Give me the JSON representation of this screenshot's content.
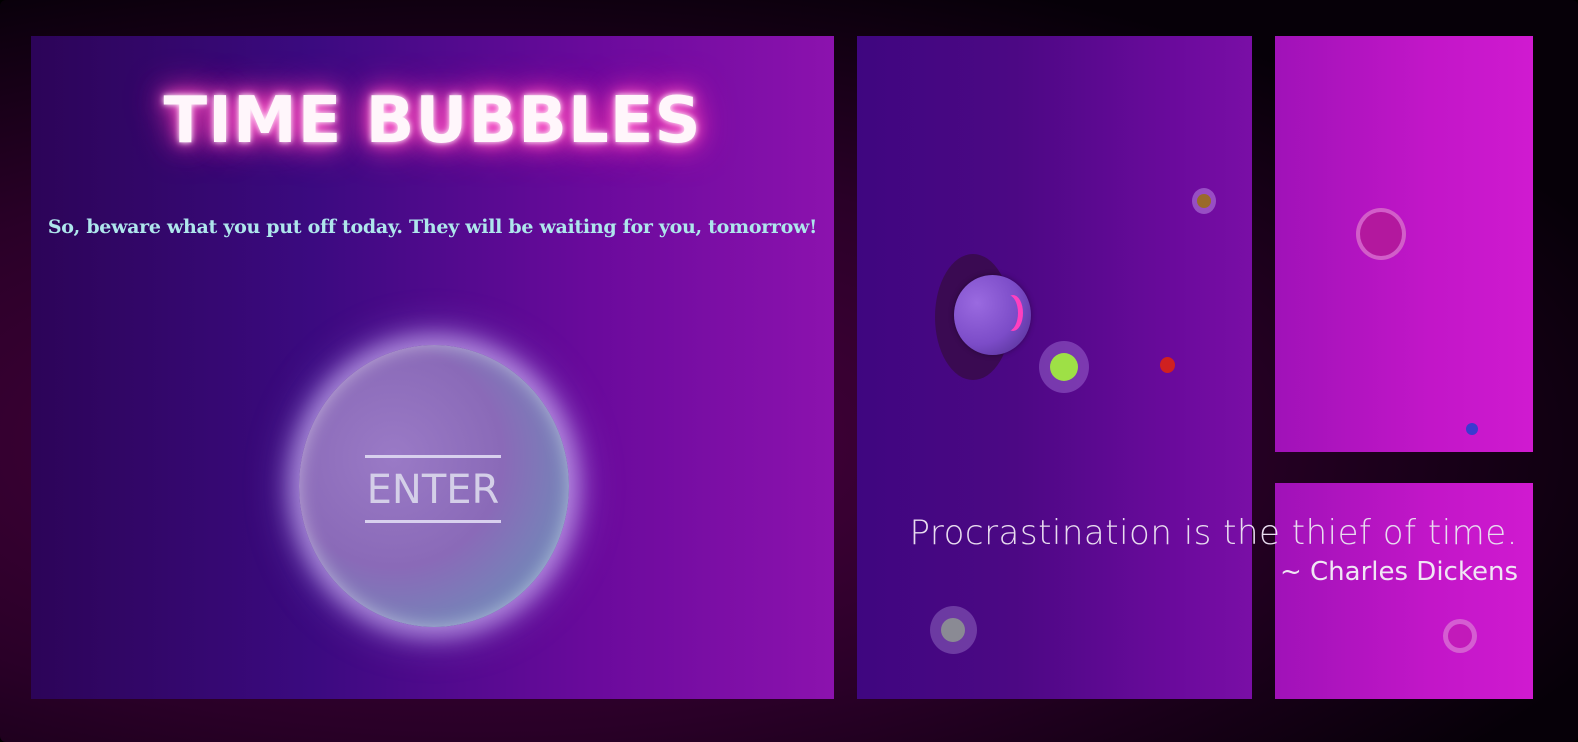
{
  "title": "TIME BUBBLES",
  "tagline": "So, beware what you put off today. They will be waiting for you, tomorrow!",
  "enter_label": "ENTER",
  "quote": {
    "text": "Procrastination is the thief of time.",
    "author": "~ Charles Dickens"
  },
  "colors": {
    "title_glow": "#ff3fb8",
    "tagline": "#aee6ec",
    "bubble_green": "#9ee046",
    "bubble_red": "#d02020",
    "bubble_blue": "#3a3ad0",
    "bubble_brown": "#9a6a2a"
  }
}
